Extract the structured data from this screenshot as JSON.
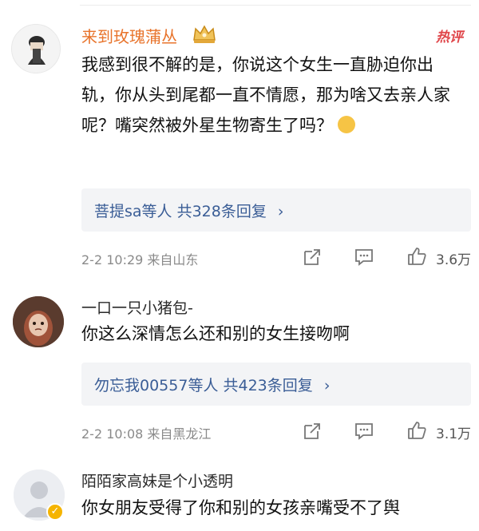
{
  "comments": [
    {
      "username": "来到玫瑰蒲丛",
      "badge": "热评",
      "text": "我感到很不解的是，你说这个女生一直胁迫你出轨，你从头到尾都一直不情愿，那为啥又去亲人家呢？嘴突然被外星生物寄生了吗？",
      "replies": {
        "users_label": "菩提sa等人",
        "count_label": "共328条回复"
      },
      "time_location": "2-2 10:29 来自山东",
      "likes": "3.6万"
    },
    {
      "username": "一口一只小猪包-",
      "text": "你这么深情怎么还和别的女生接吻啊",
      "replies": {
        "users_label": "勿忘我00557等人",
        "count_label": "共423条回复"
      },
      "time_location": "2-2 10:08 来自黑龙江",
      "likes": "3.1万"
    },
    {
      "username": "陌陌家高妹是个小透明",
      "text": "你女朋友受得了你和别的女孩亲嘴受不了舆"
    }
  ],
  "icons": {
    "emoji": "laughing-tears-icon",
    "share": "share-icon",
    "comment": "comment-icon",
    "like": "thumb-up-icon",
    "chevron": "chevron-right-icon",
    "crown": "crown-icon",
    "verified": "verified-badge-icon"
  },
  "colors": {
    "hot_name": "#e8742c",
    "hot_badge": "#e0464a",
    "link": "#3a5d96",
    "meta": "#8a8a8a",
    "reply_bg": "#f3f4f6"
  }
}
